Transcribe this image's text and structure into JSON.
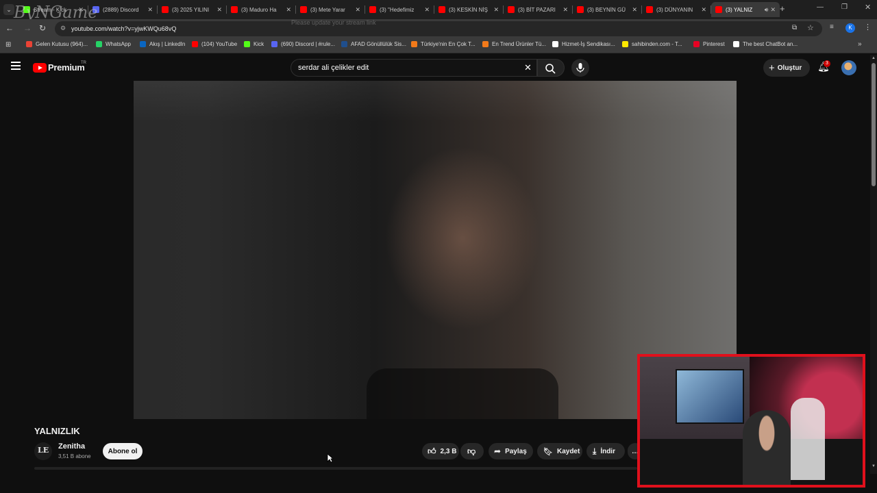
{
  "overlay_watermark": "ByNGame",
  "tabs": [
    {
      "title": "Stream - Kick",
      "color": "#53fc18"
    },
    {
      "title": "(2889) Discord",
      "color": "#5865f2"
    },
    {
      "title": "(3) 2025 YILINI",
      "color": "#ff0000"
    },
    {
      "title": "(3) Maduro Ha",
      "color": "#ff0000"
    },
    {
      "title": "(3) Mete Yarar",
      "color": "#ff0000"
    },
    {
      "title": "(3) \"Hedefimiz",
      "color": "#ff0000"
    },
    {
      "title": "(3) KESKİN NİŞ",
      "color": "#ff0000"
    },
    {
      "title": "(3) BİT PAZARI",
      "color": "#ff0000"
    },
    {
      "title": "(3) BEYNİN GÜ",
      "color": "#ff0000"
    },
    {
      "title": "(3) DÜNYANIN",
      "color": "#ff0000"
    },
    {
      "title": "(3) YALNIZ",
      "color": "#ff0000"
    }
  ],
  "address": {
    "url": "youtube.com/watch?v=yjwKWQu68vQ",
    "overlay_text": "Please update your stream link"
  },
  "bookmarks": [
    {
      "label": "Gelen Kutusu (964)...",
      "color": "#ea4335"
    },
    {
      "label": "WhatsApp",
      "color": "#25d366"
    },
    {
      "label": "Akış | LinkedIn",
      "color": "#0a66c2"
    },
    {
      "label": "(104) YouTube",
      "color": "#ff0000"
    },
    {
      "label": "Kick",
      "color": "#53fc18"
    },
    {
      "label": "(690) Discord | #rule...",
      "color": "#5865f2"
    },
    {
      "label": "AFAD Gönüllülük Sis...",
      "color": "#1f4e8c"
    },
    {
      "label": "Türkiye'nin En Çok T...",
      "color": "#f27a1a"
    },
    {
      "label": "En Trend Ürünler Tü...",
      "color": "#f27a1a"
    },
    {
      "label": "Hizmet-İş Sendikası...",
      "color": "#ffffff"
    },
    {
      "label": "sahibinden.com - T...",
      "color": "#ffe800"
    },
    {
      "label": "Pinterest",
      "color": "#e60023"
    },
    {
      "label": "The best ChatBot an...",
      "color": "#ffffff"
    }
  ],
  "youtube": {
    "logo_text": "Premium",
    "region": "TR",
    "search_value": "serdar ali çelikler edit",
    "create_label": "Oluştur",
    "notification_count": "3"
  },
  "video": {
    "title": "YALNIZLIK",
    "channel": "Zenitha",
    "subscribers": "3,51 B abone",
    "subscribe_label": "Abone ol",
    "likes": "2,3 B",
    "share_label": "Paylaş",
    "save_label": "Kaydet",
    "download_label": "İndir"
  },
  "colors": {
    "accent_red": "#ff0000",
    "cam_border": "#e0101c",
    "background": "#0f0f0f"
  }
}
